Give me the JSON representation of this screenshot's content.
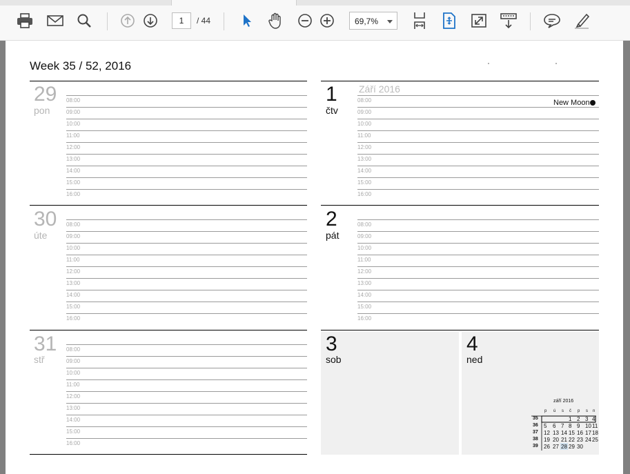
{
  "toolbar": {
    "page_current": "1",
    "page_total": "/ 44",
    "zoom": "69,7%",
    "icons": [
      "print-icon",
      "email-icon",
      "search-icon",
      "page-up-icon",
      "page-down-icon",
      "select-cursor-icon",
      "hand-tool-icon",
      "zoom-out-icon",
      "zoom-in-icon",
      "fit-width-icon",
      "fit-page-icon",
      "fullscreen-icon",
      "read-mode-icon",
      "comment-icon",
      "highlight-icon"
    ]
  },
  "planner": {
    "week_title": "Week 35 / 52, 2016",
    "month_header": "Září 2016",
    "moon_label": "New Moon",
    "times": [
      "08:00",
      "09:00",
      "10:00",
      "11:00",
      "12:00",
      "13:00",
      "14:00",
      "15:00",
      "16:00"
    ],
    "days": [
      {
        "num": "29",
        "name": "pon"
      },
      {
        "num": "30",
        "name": "úte"
      },
      {
        "num": "31",
        "name": "stř"
      },
      {
        "num": "1",
        "name": "čtv"
      },
      {
        "num": "2",
        "name": "pát"
      },
      {
        "num": "3",
        "name": "sob"
      },
      {
        "num": "4",
        "name": "ned"
      }
    ]
  },
  "mini_calendar": {
    "title": "září 2016",
    "weekday_headers": [
      "p",
      "ú",
      "s",
      "č",
      "p",
      "s",
      "n"
    ],
    "rows": [
      {
        "week": "35",
        "days": [
          "",
          "",
          "",
          "1",
          "2",
          "3",
          "4"
        ]
      },
      {
        "week": "36",
        "days": [
          "5",
          "6",
          "7",
          "8",
          "9",
          "10",
          "11"
        ]
      },
      {
        "week": "37",
        "days": [
          "12",
          "13",
          "14",
          "15",
          "16",
          "17",
          "18"
        ]
      },
      {
        "week": "38",
        "days": [
          "19",
          "20",
          "21",
          "22",
          "23",
          "24",
          "25"
        ]
      },
      {
        "week": "39",
        "days": [
          "26",
          "27",
          "28",
          "29",
          "30",
          "",
          ""
        ]
      }
    ],
    "highlight_color": "#cfe0ee"
  }
}
